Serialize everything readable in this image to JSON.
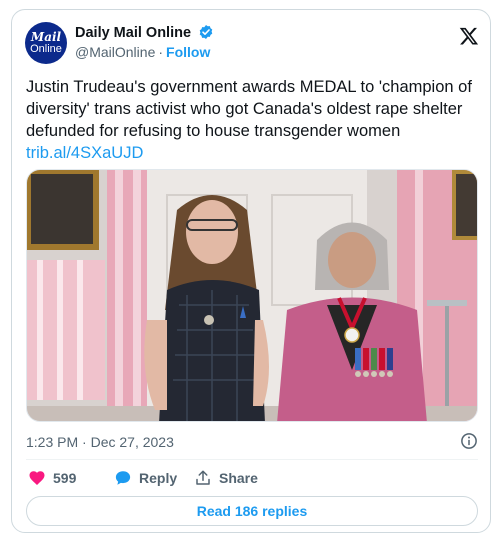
{
  "header": {
    "avatar_line1": "Mail",
    "avatar_line2": "Online",
    "display_name": "Daily Mail Online",
    "handle": "@MailOnline",
    "separator": "·",
    "follow_label": "Follow"
  },
  "tweet": {
    "text": "Justin Trudeau's government awards MEDAL to 'champion of diversity' trans activist who got Canada's oldest rape shelter defunded for refusing to house transgender women",
    "link": "trib.al/4SXaUJD"
  },
  "meta": {
    "timestamp": "1:23 PM · Dec 27, 2023"
  },
  "actions": {
    "like_count": "599",
    "reply_label": "Reply",
    "share_label": "Share",
    "read_replies_label": "Read 186 replies"
  },
  "colors": {
    "accent": "#1d9bf0",
    "like": "#f91880",
    "muted": "#536471",
    "verified": "#1d9bf0",
    "avatar_bg": "#0c2a8c"
  },
  "icons": {
    "verified": "verified-badge-icon",
    "x_logo": "x-logo-icon",
    "info": "info-icon",
    "like": "heart-icon",
    "reply": "reply-bubble-icon",
    "share": "share-upload-icon"
  }
}
